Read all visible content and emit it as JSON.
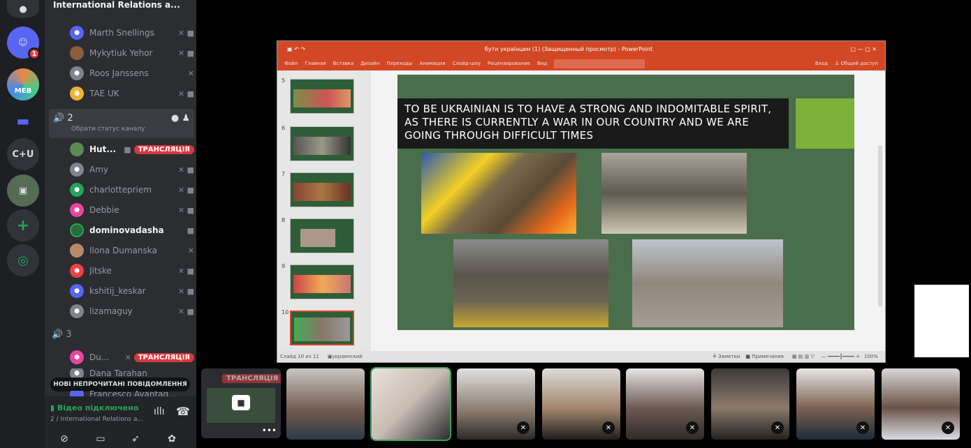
{
  "server_rail": {
    "servers": [
      {
        "icon": "discord-logo-icon"
      },
      {
        "icon": "discord-avatar-icon",
        "badge": "1"
      },
      {
        "label": "MEB"
      },
      {
        "icon": "folder-icon"
      },
      {
        "label": "C+U"
      },
      {
        "icon": "server-avatar-icon"
      },
      {
        "icon": "add-server-icon"
      },
      {
        "icon": "explore-icon"
      }
    ]
  },
  "sidebar": {
    "server_name": "International Relations a...",
    "users_top": [
      {
        "name": "Marth Snellings",
        "color": "#5865f2"
      },
      {
        "name": "Mykytiuk Yehor",
        "color": "#8b5e3c"
      },
      {
        "name": "Roos Janssens",
        "color": "#80848e"
      },
      {
        "name": "TAE UK",
        "color": "#f0b232"
      }
    ],
    "channel2": {
      "name": "2",
      "status_hint": "Обрати статус каналу"
    },
    "users_ch2": [
      {
        "name": "Hut...",
        "color": "#5b8a55",
        "live": "ТРАНСЛЯЦІЯ"
      },
      {
        "name": "Amy",
        "color": "#80848e"
      },
      {
        "name": "charlottepriem",
        "color": "#23a55a"
      },
      {
        "name": "Debbie",
        "color": "#eb459e"
      },
      {
        "name": "dominovadasha",
        "color": "#2a6b3a"
      },
      {
        "name": "Ilona Dumanska",
        "color": "#b98a6a"
      },
      {
        "name": "Jitske",
        "color": "#f23f43"
      },
      {
        "name": "kshitij_keskar",
        "color": "#5865f2"
      },
      {
        "name": "lizamaguy",
        "color": "#80848e"
      }
    ],
    "channel3": {
      "name": "3"
    },
    "users_ch3": [
      {
        "name": "Du...",
        "color": "#eb459e",
        "live": "ТРАНСЛЯЦІЯ"
      },
      {
        "name": "Dana Tarahan",
        "color": "#80848e"
      },
      {
        "name": "Francesco Avantag...",
        "color": "#5865f2"
      }
    ],
    "new_messages_banner": "НОВІ НЕПРОЧИТАНІ ПОВІДОМЛЕННЯ",
    "voice_status": "Відео підключено",
    "voice_channel": "2 / International Relations a..."
  },
  "stream_preview": {
    "label": "ТРАНСЛЯЦІЯ"
  },
  "powerpoint": {
    "title": "бути українцем (1) (Защищенный просмотр) - PowerPoint",
    "menu": [
      "Файл",
      "Главная",
      "Вставка",
      "Дизайн",
      "Переходы",
      "Анимация",
      "Слайд-шоу",
      "Рецензирование",
      "Вид"
    ],
    "login": "Вход",
    "share": "Общий доступ",
    "slide_numbers": [
      "5",
      "6",
      "7",
      "8",
      "9",
      "10"
    ],
    "selected_slide": "10",
    "headline": "TO BE UKRAINIAN IS TO HAVE A STRONG AND INDOMITABLE SPIRIT, AS THERE IS CURRENTLY A WAR IN OUR COUNTRY AND WE ARE GOING THROUGH DIFFICULT TIMES",
    "status_left": "Слайд 10 из 11",
    "status_lang": "украинский",
    "status_notes": "Заметки",
    "status_comments": "Примечания",
    "zoom": "100%"
  },
  "video_tiles": [
    {
      "kind": "camera"
    },
    {
      "kind": "camera",
      "speaking": true
    },
    {
      "kind": "camera",
      "muted": true
    },
    {
      "kind": "camera",
      "muted": true
    },
    {
      "kind": "camera",
      "muted": true
    },
    {
      "kind": "camera",
      "muted": true
    },
    {
      "kind": "camera",
      "muted": true
    },
    {
      "kind": "camera",
      "muted": true
    }
  ]
}
